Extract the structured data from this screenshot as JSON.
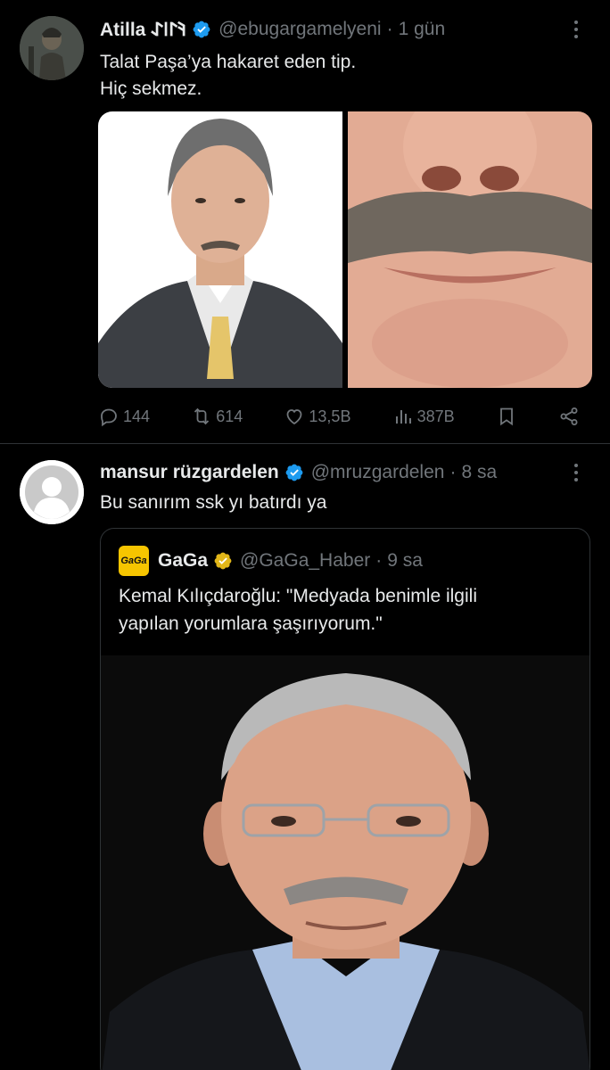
{
  "tweet1": {
    "name": "Atilla 𐰚𐰃𐰾𐰀",
    "handle": "@ebugargamelyeni",
    "time": "1 gün",
    "text": "Talat Paşa’ya hakaret eden tip.\nHiç sekmez.",
    "actions": {
      "replies": "144",
      "reposts": "614",
      "likes": "13,5B",
      "views": "387B"
    }
  },
  "tweet2": {
    "name": "mansur rüzgardelen",
    "handle": "@mruzgardelen",
    "time": "8 sa",
    "text": "Bu sanırım ssk yı batırdı ya",
    "quote": {
      "logo_text": "GaGa",
      "name": "GaGa",
      "handle": "@GaGa_Haber",
      "time": "9 sa",
      "text": "Kemal Kılıçdaroğlu: \"Medyada benimle ilgili\nyapılan yorumlara şaşırıyorum.\""
    }
  },
  "colors": {
    "background": "#000000",
    "text": "#e7e9ea",
    "muted": "#71767b",
    "verified_blue": "#1d9bf0",
    "verified_gold": "#e2b719",
    "border": "#2f3336"
  },
  "icons": [
    "reply-icon",
    "repost-icon",
    "like-icon",
    "views-icon",
    "bookmark-icon",
    "share-icon",
    "more-icon",
    "verified-badge-icon"
  ]
}
